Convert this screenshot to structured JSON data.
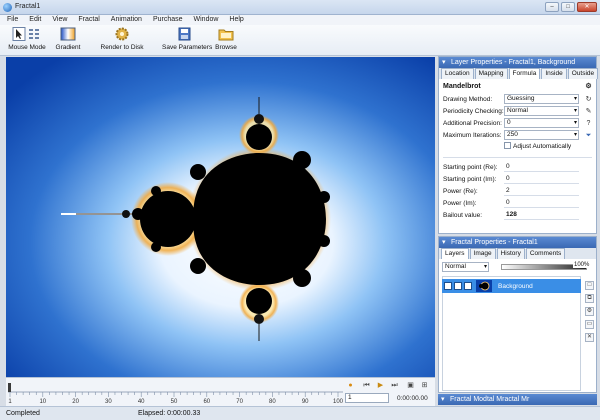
{
  "window": {
    "title": "Fractal1"
  },
  "menu": [
    "File",
    "Edit",
    "View",
    "Fractal",
    "Animation",
    "Purchase",
    "Window",
    "Help"
  ],
  "toolbar": {
    "mouse_mode": "Mouse Mode",
    "gradient": "Gradient",
    "render_to_disk": "Render to Disk",
    "save_parameters": "Save Parameters",
    "browse": "Browse"
  },
  "layer_properties": {
    "title": "Layer Properties - Fractal1, Background",
    "tabs": [
      "Location",
      "Mapping",
      "Formula",
      "Inside",
      "Outside"
    ],
    "active_tab": "Formula",
    "formula_name": "Mandelbrot",
    "drawing_method": {
      "label": "Drawing Method:",
      "value": "Guessing"
    },
    "periodicity": {
      "label": "Periodicity Checking:",
      "value": "Normal"
    },
    "precision": {
      "label": "Additional Precision:",
      "value": "0"
    },
    "iterations": {
      "label": "Maximum Iterations:",
      "value": "250"
    },
    "adjust_auto": "Adjust Automatically",
    "start_re": {
      "label": "Starting point (Re):",
      "value": "0"
    },
    "start_im": {
      "label": "Starting point (Im):",
      "value": "0"
    },
    "power_re": {
      "label": "Power (Re):",
      "value": "2"
    },
    "power_im": {
      "label": "Power (Im):",
      "value": "0"
    },
    "bailout": {
      "label": "Bailout value:",
      "value": "128"
    }
  },
  "fractal_properties": {
    "title": "Fractal Properties - Fractal1",
    "tabs": [
      "Layers",
      "Image",
      "History",
      "Comments"
    ],
    "active_tab": "Layers",
    "blend_mode": "Normal",
    "opacity": "100%",
    "layer_name": "Background"
  },
  "bottom_panel_title": "Fractal Modtal Mractal Mr",
  "timeline": {
    "ticks": [
      "1",
      "10",
      "20",
      "30",
      "40",
      "50",
      "60",
      "70",
      "80",
      "90",
      "100"
    ],
    "frame": "1",
    "time": "0:00:00.00"
  },
  "status": {
    "text": "Completed",
    "elapsed": "Elapsed: 0:00:00.33"
  },
  "colors": {
    "accent": "#3a68b3",
    "selection": "#3a8ee6",
    "fractal_outer": "#0a3fa8",
    "fractal_glow": "#ffd27a"
  }
}
